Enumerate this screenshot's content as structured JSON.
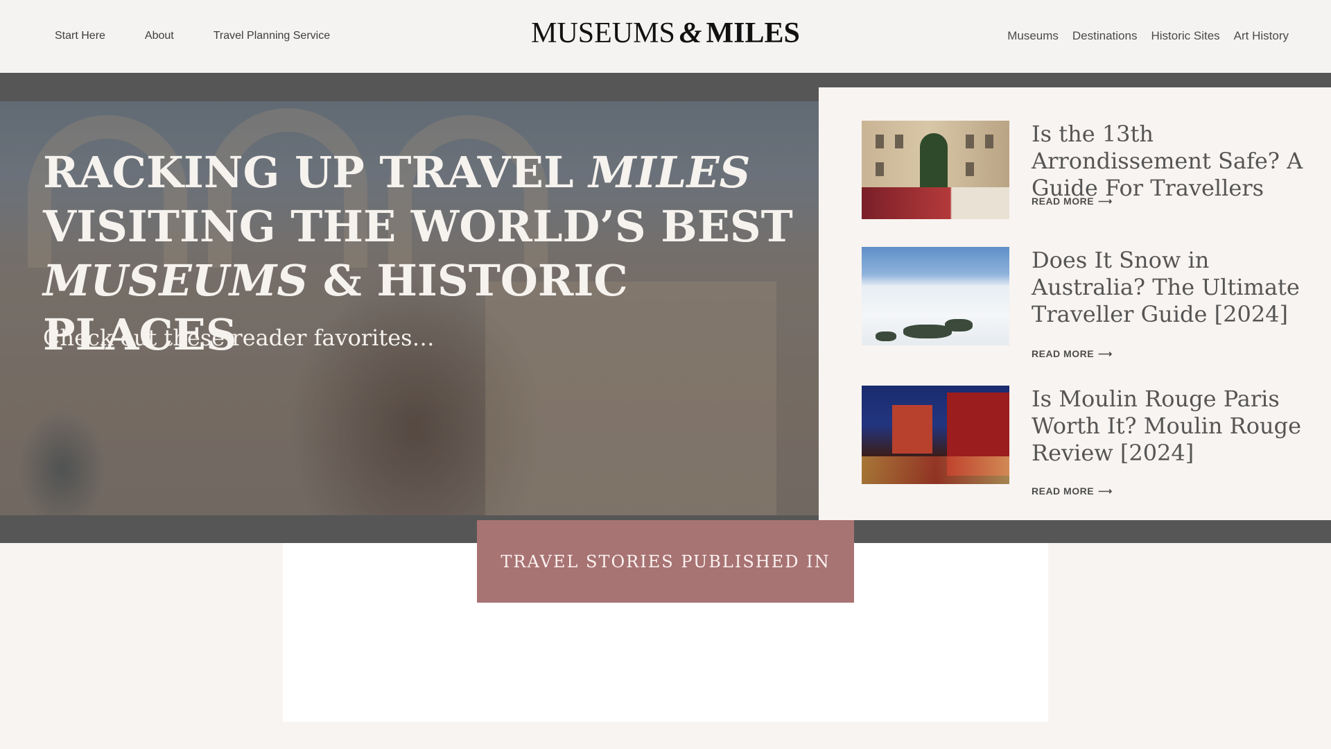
{
  "nav": {
    "left": [
      {
        "label": "Start Here"
      },
      {
        "label": "About"
      },
      {
        "label": "Travel Planning Service"
      }
    ],
    "right": [
      {
        "label": "Museums"
      },
      {
        "label": "Destinations"
      },
      {
        "label": "Historic Sites"
      },
      {
        "label": "Art History"
      }
    ]
  },
  "logo": {
    "part1": "MUSEUMS",
    "amp": "&",
    "part2": "MILES"
  },
  "hero": {
    "line1_text": "RACKING UP TRAVEL ",
    "line1_italic": "MILES",
    "line2": "VISITING THE WORLD’S BEST",
    "line3_italic": "MUSEUMS",
    "line3_text": " & HISTORIC PLACES",
    "subtitle": "Check out these reader favorites…"
  },
  "favorites": [
    {
      "title": "Is the 13th Arrondissement Safe? A Guide For Travellers",
      "cta": "READ MORE",
      "icon": "arrow-right-icon"
    },
    {
      "title": "Does It Snow in Australia? The Ultimate Traveller Guide [2024]",
      "cta": "READ MORE",
      "icon": "arrow-right-icon"
    },
    {
      "title": "Is Moulin Rouge Paris Worth It? Moulin Rouge Review [2024]",
      "cta": "READ MORE",
      "icon": "arrow-right-icon"
    }
  ],
  "published": {
    "label": "TRAVEL STORIES PUBLISHED IN"
  },
  "colors": {
    "header_bg": "#f4f3f1",
    "band": "#565656",
    "accent": "#a87373",
    "page_bg": "#f8f4f1"
  }
}
